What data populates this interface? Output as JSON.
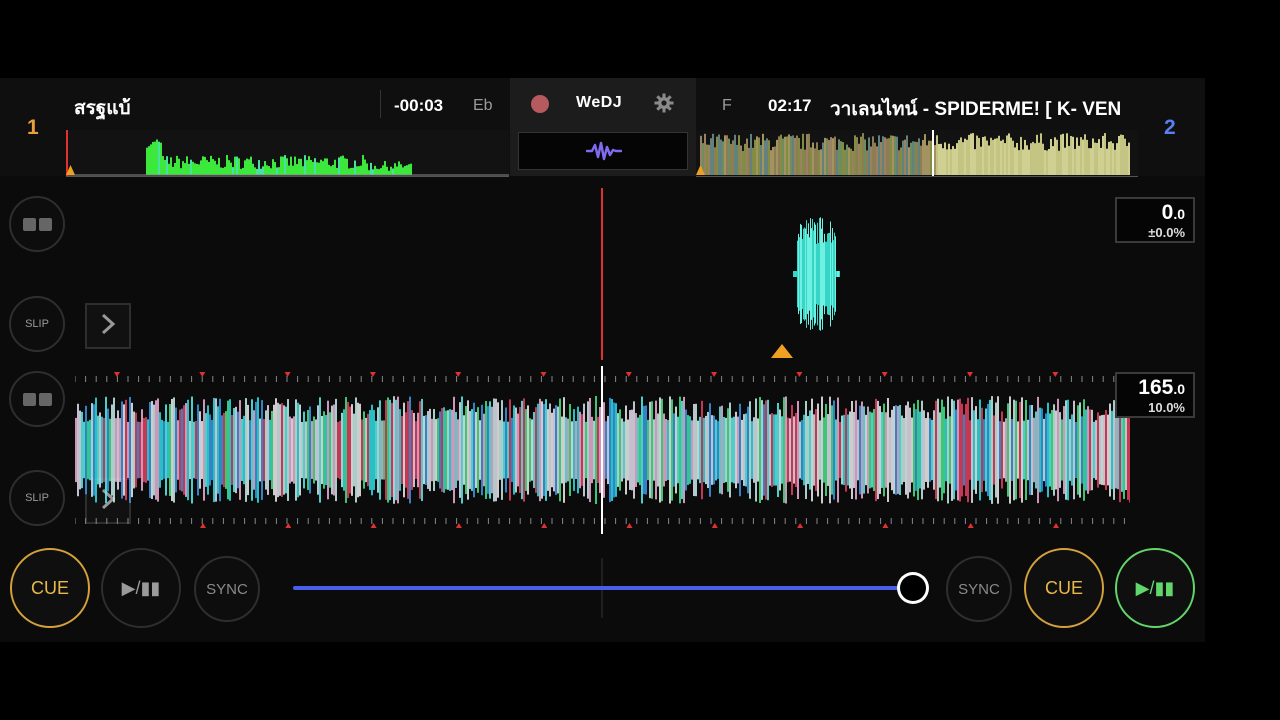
{
  "app": {
    "name": "WeDJ"
  },
  "deck1": {
    "number": "1",
    "title": "สรฐแบ้",
    "time": "-00:03",
    "key": "Eb",
    "bpm_main": "165",
    "bpm_decimal": ".0",
    "pitch": "10.0%",
    "slip_label": "SLIP",
    "cue_label": "CUE",
    "play_label": "▶/▮▮",
    "sync_label": "SYNC"
  },
  "deck2": {
    "number": "2",
    "title": "วาเลนไทน์ - SPIDERME! [ K- VEN",
    "time": "02:17",
    "key": "F",
    "bpm_main": "0",
    "bpm_decimal": ".0",
    "pitch": "±0.0%",
    "slip_label": "SLIP",
    "cue_label": "CUE",
    "play_label": "▶/▮▮",
    "sync_label": "SYNC"
  },
  "crossfader": {
    "position": 1.0
  },
  "colors": {
    "deck1_number": "#e8a13a",
    "deck2_number": "#5a7ff0",
    "cue_ring": "#d4a13a",
    "play_active": "#62d66b",
    "crossfader": "#4a5ee8",
    "playhead": "#e03030",
    "record": "#b55a5e"
  },
  "icons": {
    "record": "record-icon",
    "settings": "gear-icon",
    "waveform": "waveform-icon",
    "layout": "layout-toggle-icon",
    "chevron": "chevron-right-icon"
  }
}
